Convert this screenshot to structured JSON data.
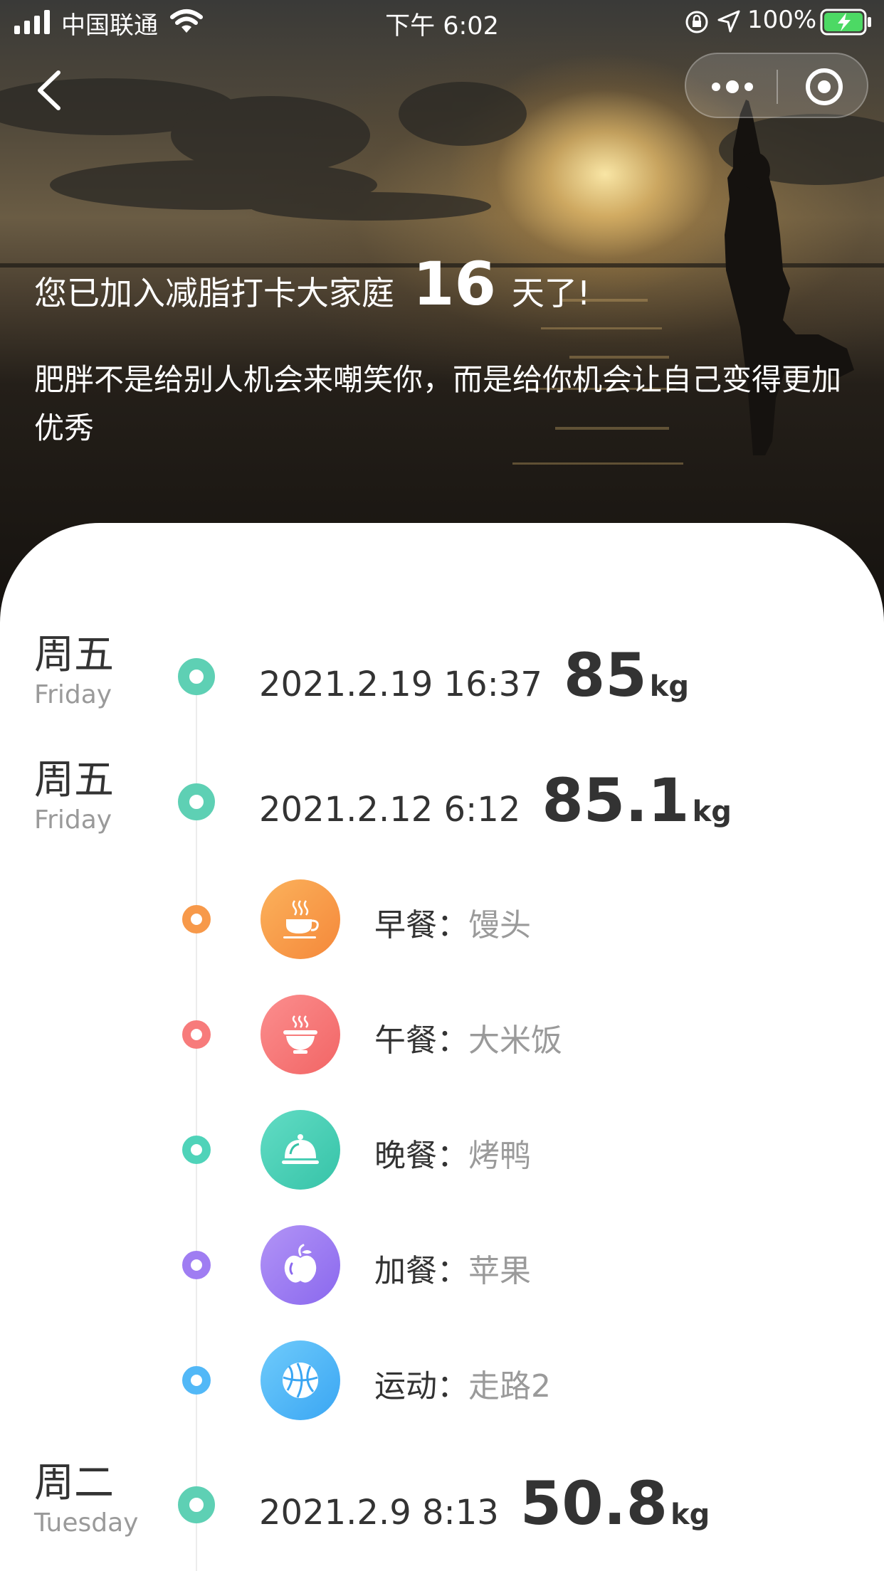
{
  "status_bar": {
    "carrier": "中国联通",
    "time": "下午 6:02",
    "battery": "100%"
  },
  "hero": {
    "joined_prefix": "您已加入减脂打卡大家庭",
    "days": "16",
    "joined_suffix": "天了!",
    "motto": "肥胖不是给别人机会来嘲笑你，而是给你机会让自己变得更加优秀"
  },
  "records": [
    {
      "day_cn": "周五",
      "day_en": "Friday",
      "datetime": "2021.2.19 16:37",
      "weight": "85",
      "unit": "kg"
    },
    {
      "day_cn": "周五",
      "day_en": "Friday",
      "datetime": "2021.2.12 6:12",
      "weight": "85.1",
      "unit": "kg"
    },
    {
      "day_cn": "周二",
      "day_en": "Tuesday",
      "datetime": "2021.2.9 8:13",
      "weight": "50.8",
      "unit": "kg"
    }
  ],
  "meals": [
    {
      "label": "早餐：",
      "value": "馒头",
      "icon": "coffee-cup-icon",
      "color": "#f7994a"
    },
    {
      "label": "午餐：",
      "value": "大米饭",
      "icon": "rice-bowl-icon",
      "color": "#f77b7b"
    },
    {
      "label": "晚餐：",
      "value": "烤鸭",
      "icon": "food-cloche-icon",
      "color": "#4fd3b9"
    },
    {
      "label": "加餐：",
      "value": "苹果",
      "icon": "apple-icon",
      "color": "#9f7df2"
    },
    {
      "label": "运动：",
      "value": "走路2",
      "icon": "basketball-icon",
      "color": "#52b8f7"
    }
  ],
  "colors": {
    "timeline_accent": "#5ed0b4",
    "text_primary": "#333333",
    "text_secondary": "#9a9a9a"
  }
}
